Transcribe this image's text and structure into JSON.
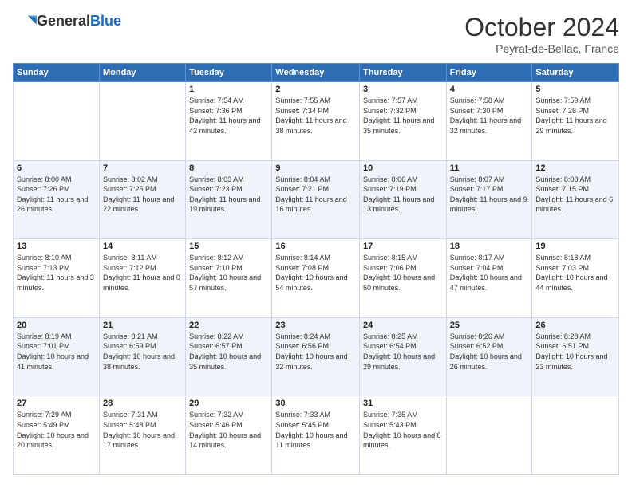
{
  "logo": {
    "general": "General",
    "blue": "Blue"
  },
  "header": {
    "month": "October 2024",
    "location": "Peyrat-de-Bellac, France"
  },
  "weekdays": [
    "Sunday",
    "Monday",
    "Tuesday",
    "Wednesday",
    "Thursday",
    "Friday",
    "Saturday"
  ],
  "weeks": [
    [
      {
        "day": "",
        "sunrise": "",
        "sunset": "",
        "daylight": ""
      },
      {
        "day": "",
        "sunrise": "",
        "sunset": "",
        "daylight": ""
      },
      {
        "day": "1",
        "sunrise": "Sunrise: 7:54 AM",
        "sunset": "Sunset: 7:36 PM",
        "daylight": "Daylight: 11 hours and 42 minutes."
      },
      {
        "day": "2",
        "sunrise": "Sunrise: 7:55 AM",
        "sunset": "Sunset: 7:34 PM",
        "daylight": "Daylight: 11 hours and 38 minutes."
      },
      {
        "day": "3",
        "sunrise": "Sunrise: 7:57 AM",
        "sunset": "Sunset: 7:32 PM",
        "daylight": "Daylight: 11 hours and 35 minutes."
      },
      {
        "day": "4",
        "sunrise": "Sunrise: 7:58 AM",
        "sunset": "Sunset: 7:30 PM",
        "daylight": "Daylight: 11 hours and 32 minutes."
      },
      {
        "day": "5",
        "sunrise": "Sunrise: 7:59 AM",
        "sunset": "Sunset: 7:28 PM",
        "daylight": "Daylight: 11 hours and 29 minutes."
      }
    ],
    [
      {
        "day": "6",
        "sunrise": "Sunrise: 8:00 AM",
        "sunset": "Sunset: 7:26 PM",
        "daylight": "Daylight: 11 hours and 26 minutes."
      },
      {
        "day": "7",
        "sunrise": "Sunrise: 8:02 AM",
        "sunset": "Sunset: 7:25 PM",
        "daylight": "Daylight: 11 hours and 22 minutes."
      },
      {
        "day": "8",
        "sunrise": "Sunrise: 8:03 AM",
        "sunset": "Sunset: 7:23 PM",
        "daylight": "Daylight: 11 hours and 19 minutes."
      },
      {
        "day": "9",
        "sunrise": "Sunrise: 8:04 AM",
        "sunset": "Sunset: 7:21 PM",
        "daylight": "Daylight: 11 hours and 16 minutes."
      },
      {
        "day": "10",
        "sunrise": "Sunrise: 8:06 AM",
        "sunset": "Sunset: 7:19 PM",
        "daylight": "Daylight: 11 hours and 13 minutes."
      },
      {
        "day": "11",
        "sunrise": "Sunrise: 8:07 AM",
        "sunset": "Sunset: 7:17 PM",
        "daylight": "Daylight: 11 hours and 9 minutes."
      },
      {
        "day": "12",
        "sunrise": "Sunrise: 8:08 AM",
        "sunset": "Sunset: 7:15 PM",
        "daylight": "Daylight: 11 hours and 6 minutes."
      }
    ],
    [
      {
        "day": "13",
        "sunrise": "Sunrise: 8:10 AM",
        "sunset": "Sunset: 7:13 PM",
        "daylight": "Daylight: 11 hours and 3 minutes."
      },
      {
        "day": "14",
        "sunrise": "Sunrise: 8:11 AM",
        "sunset": "Sunset: 7:12 PM",
        "daylight": "Daylight: 11 hours and 0 minutes."
      },
      {
        "day": "15",
        "sunrise": "Sunrise: 8:12 AM",
        "sunset": "Sunset: 7:10 PM",
        "daylight": "Daylight: 10 hours and 57 minutes."
      },
      {
        "day": "16",
        "sunrise": "Sunrise: 8:14 AM",
        "sunset": "Sunset: 7:08 PM",
        "daylight": "Daylight: 10 hours and 54 minutes."
      },
      {
        "day": "17",
        "sunrise": "Sunrise: 8:15 AM",
        "sunset": "Sunset: 7:06 PM",
        "daylight": "Daylight: 10 hours and 50 minutes."
      },
      {
        "day": "18",
        "sunrise": "Sunrise: 8:17 AM",
        "sunset": "Sunset: 7:04 PM",
        "daylight": "Daylight: 10 hours and 47 minutes."
      },
      {
        "day": "19",
        "sunrise": "Sunrise: 8:18 AM",
        "sunset": "Sunset: 7:03 PM",
        "daylight": "Daylight: 10 hours and 44 minutes."
      }
    ],
    [
      {
        "day": "20",
        "sunrise": "Sunrise: 8:19 AM",
        "sunset": "Sunset: 7:01 PM",
        "daylight": "Daylight: 10 hours and 41 minutes."
      },
      {
        "day": "21",
        "sunrise": "Sunrise: 8:21 AM",
        "sunset": "Sunset: 6:59 PM",
        "daylight": "Daylight: 10 hours and 38 minutes."
      },
      {
        "day": "22",
        "sunrise": "Sunrise: 8:22 AM",
        "sunset": "Sunset: 6:57 PM",
        "daylight": "Daylight: 10 hours and 35 minutes."
      },
      {
        "day": "23",
        "sunrise": "Sunrise: 8:24 AM",
        "sunset": "Sunset: 6:56 PM",
        "daylight": "Daylight: 10 hours and 32 minutes."
      },
      {
        "day": "24",
        "sunrise": "Sunrise: 8:25 AM",
        "sunset": "Sunset: 6:54 PM",
        "daylight": "Daylight: 10 hours and 29 minutes."
      },
      {
        "day": "25",
        "sunrise": "Sunrise: 8:26 AM",
        "sunset": "Sunset: 6:52 PM",
        "daylight": "Daylight: 10 hours and 26 minutes."
      },
      {
        "day": "26",
        "sunrise": "Sunrise: 8:28 AM",
        "sunset": "Sunset: 6:51 PM",
        "daylight": "Daylight: 10 hours and 23 minutes."
      }
    ],
    [
      {
        "day": "27",
        "sunrise": "Sunrise: 7:29 AM",
        "sunset": "Sunset: 5:49 PM",
        "daylight": "Daylight: 10 hours and 20 minutes."
      },
      {
        "day": "28",
        "sunrise": "Sunrise: 7:31 AM",
        "sunset": "Sunset: 5:48 PM",
        "daylight": "Daylight: 10 hours and 17 minutes."
      },
      {
        "day": "29",
        "sunrise": "Sunrise: 7:32 AM",
        "sunset": "Sunset: 5:46 PM",
        "daylight": "Daylight: 10 hours and 14 minutes."
      },
      {
        "day": "30",
        "sunrise": "Sunrise: 7:33 AM",
        "sunset": "Sunset: 5:45 PM",
        "daylight": "Daylight: 10 hours and 11 minutes."
      },
      {
        "day": "31",
        "sunrise": "Sunrise: 7:35 AM",
        "sunset": "Sunset: 5:43 PM",
        "daylight": "Daylight: 10 hours and 8 minutes."
      },
      {
        "day": "",
        "sunrise": "",
        "sunset": "",
        "daylight": ""
      },
      {
        "day": "",
        "sunrise": "",
        "sunset": "",
        "daylight": ""
      }
    ]
  ]
}
